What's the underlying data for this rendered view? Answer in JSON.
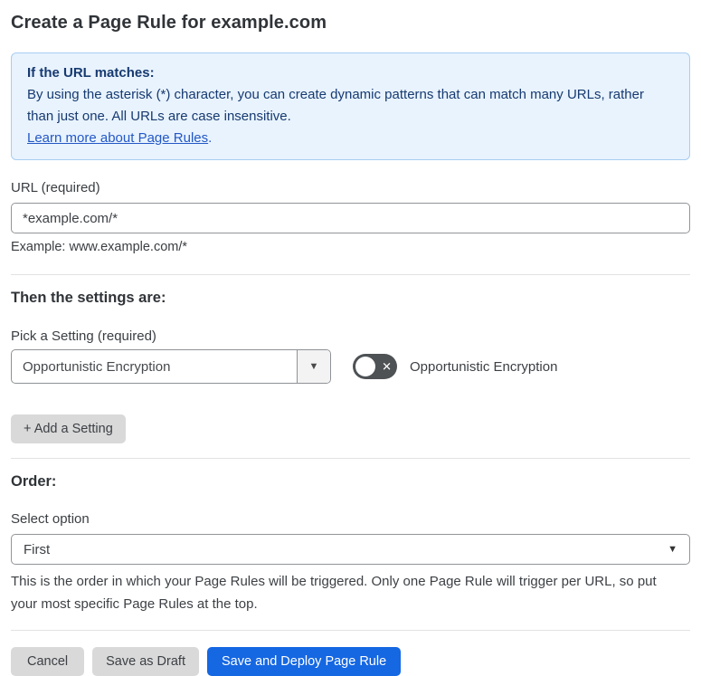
{
  "page": {
    "title": "Create a Page Rule for example.com"
  },
  "callout": {
    "heading": "If the URL matches:",
    "body": "By using the asterisk (*) character, you can create dynamic patterns that can match many URLs, rather than just one. All URLs are case insensitive.",
    "link_label": "Learn more about Page Rules",
    "link_suffix": "."
  },
  "url_field": {
    "label": "URL (required)",
    "value": "*example.com/*",
    "example": "Example: www.example.com/*"
  },
  "settings_section": {
    "heading": "Then the settings are:",
    "setting_label": "Pick a Setting (required)",
    "setting_value": "Opportunistic Encryption",
    "toggle": {
      "state": "off",
      "label": "Opportunistic Encryption"
    },
    "add_setting_label": "+ Add a Setting"
  },
  "order_section": {
    "heading": "Order:",
    "select_label": "Select option",
    "select_value": "First",
    "description": "This is the order in which your Page Rules will be triggered. Only one Page Rule will trigger per URL, so put your most specific Page Rules at the top."
  },
  "actions": {
    "cancel": "Cancel",
    "save_draft": "Save as Draft",
    "save_deploy": "Save and Deploy Page Rule"
  },
  "icons": {
    "dropdown_arrow": "▼",
    "toggle_x": "✕"
  },
  "colors": {
    "callout_bg": "#e8f3fe",
    "callout_border": "#a9cdf2",
    "callout_text": "#173a70",
    "link_blue": "#2458c5",
    "toggle_off_bg": "#4e5255",
    "button_gray": "#d9d9d9",
    "button_blue": "#1567e2",
    "divider": "#e2e2e2"
  }
}
